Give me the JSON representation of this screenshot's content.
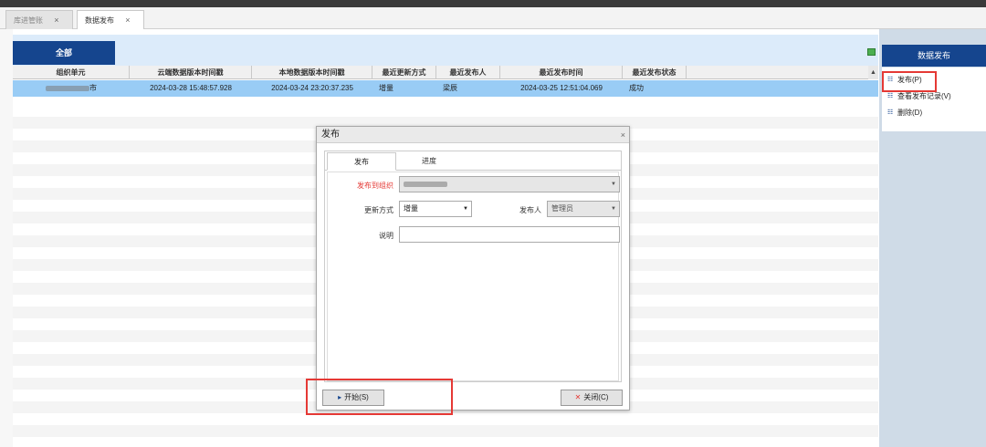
{
  "tabs": [
    {
      "label": "库进管账"
    },
    {
      "label": "数据发布"
    }
  ],
  "close_glyph": "×",
  "toolbar": {
    "all_label": "全部"
  },
  "grid": {
    "columns": [
      "组织单元",
      "云端数据版本时间戳",
      "本地数据版本时间戳",
      "最近更新方式",
      "最近发布人",
      "最近发布时间",
      "最近发布状态"
    ],
    "row": {
      "org_suffix": "市",
      "cloud_ts": "2024-03-28 15:48:57.928",
      "local_ts": "2024-03-24 23:20:37.235",
      "update_mode": "增量",
      "publisher": "梁辰",
      "publish_time": "2024-03-25 12:51:04.069",
      "status": "成功"
    }
  },
  "right_panel": {
    "title": "数据发布",
    "items": [
      {
        "label": "发布(P)"
      },
      {
        "label": "查看发布记录(V)"
      },
      {
        "label": "删除(D)"
      }
    ]
  },
  "dialog": {
    "title": "发布",
    "tabs": [
      {
        "label": "发布"
      },
      {
        "label": "进度"
      }
    ],
    "publish_to_org_label": "发布到组织",
    "update_mode_label": "更新方式",
    "update_mode_value": "增量",
    "publisher_label": "发布人",
    "publisher_value": "管理员",
    "note_label": "说明",
    "start_label": "开始(S)",
    "close_label": "关闭(C)"
  },
  "icons": {
    "close": "close-icon",
    "menu_item": "list-icon",
    "dropdown": "chevron-down-icon",
    "play": "play-icon",
    "red_x": "red-x-icon"
  },
  "colors": {
    "accent": "#15458e",
    "selected_row": "#99ccf5",
    "highlight": "#e53935"
  }
}
